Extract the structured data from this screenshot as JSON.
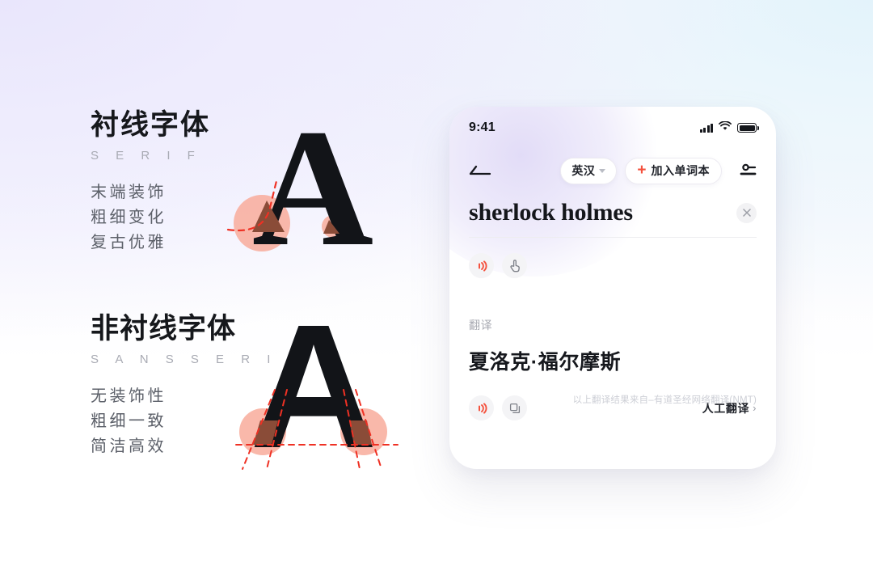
{
  "background": {
    "top_left_color": "#e9e6fc",
    "top_right_color": "#e3f3fb",
    "bottom_color": "#ffffff"
  },
  "left_panel": {
    "serif": {
      "title": "衬线字体",
      "subtitle": "S E R I F",
      "features": [
        "末端装饰",
        "粗细变化",
        "复古优雅"
      ],
      "glyph": "A",
      "accent_circle_color": "#f8ac9b",
      "serif_highlight_color": "#8a4c38",
      "guide_line_color": "#ef3124"
    },
    "sans": {
      "title": "非衬线字体",
      "subtitle": "S A N S   S E R I F",
      "features": [
        "无装饰性",
        "粗细一致",
        "简洁高效"
      ],
      "glyph": "A",
      "accent_circle_color": "#f8ac9b",
      "serif_highlight_color": "#8a4c38",
      "guide_line_color": "#ef3124"
    }
  },
  "phone": {
    "status_bar": {
      "time": "9:41",
      "signal_icon": "cellular-signal-icon",
      "wifi_icon": "wifi-icon",
      "battery_icon": "battery-full-icon"
    },
    "nav": {
      "back_icon": "back-arrow-icon",
      "language_label": "英汉",
      "language_caret_icon": "chevron-down-icon",
      "add_wordbook_plus": "+",
      "add_wordbook_label": "加入单词本",
      "add_wordbook_plus_color": "#f4513d",
      "settings_icon": "settings-sliders-icon"
    },
    "search": {
      "word": "sherlock holmes",
      "clear_icon": "close-icon"
    },
    "word_actions": [
      {
        "icon": "speaker-sound-icon",
        "color": "#f4513d"
      },
      {
        "icon": "hand-tap-icon",
        "color": "#7d8088"
      }
    ],
    "translation": {
      "label": "翻译",
      "text": "夏洛克·福尔摩斯",
      "actions": [
        {
          "icon": "speaker-sound-icon",
          "color": "#f4513d"
        },
        {
          "icon": "copy-icon",
          "color": "#7d8088"
        }
      ],
      "human_translate_label": "人工翻译",
      "human_translate_chevron": "›",
      "source_note": "以上翻译结果来自–有道圣经网络翻译(NMT)"
    }
  }
}
